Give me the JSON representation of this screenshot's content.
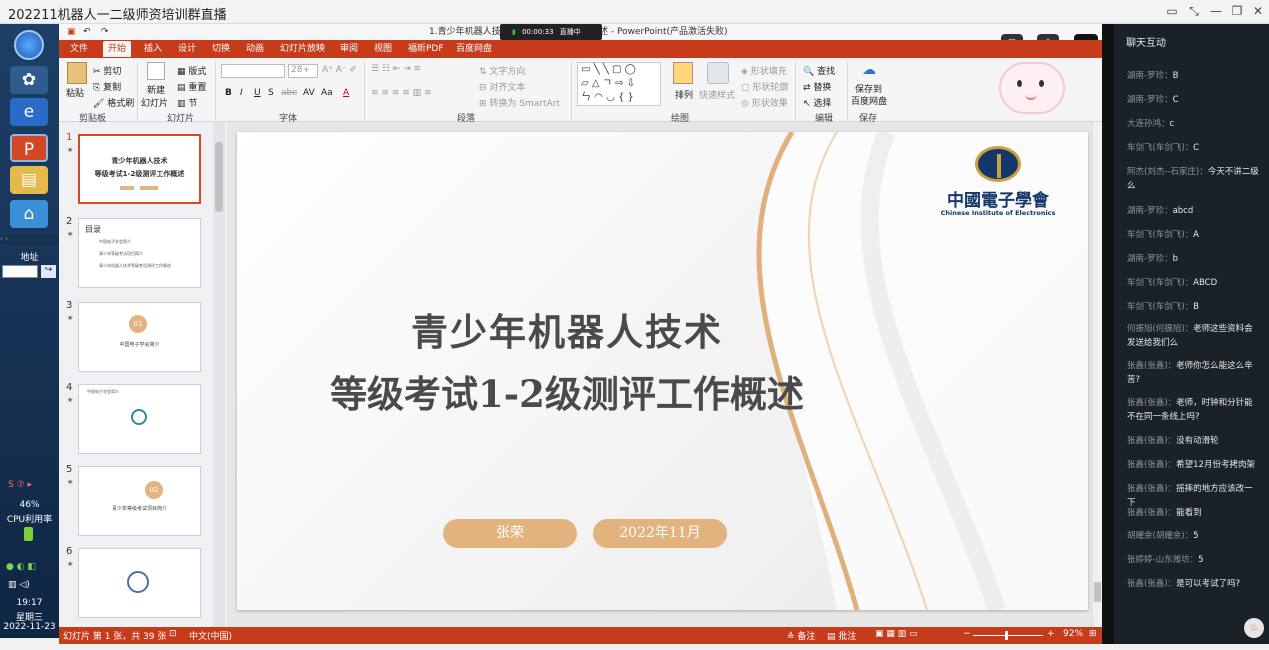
{
  "window": {
    "title": "202211机器人一二级师资培训群直播",
    "controls": [
      "pin-icon",
      "fullscreen-icon",
      "minimize-icon",
      "restore-icon",
      "close-icon"
    ]
  },
  "live": {
    "time": "00:00:33",
    "label": "直播中"
  },
  "ppt": {
    "title_left": "1.青少年机器人技",
    "title_right": "述 - PowerPoint(产品激活失败)",
    "qat": {
      "save": "save-icon",
      "undo": "undo-icon",
      "redo": "redo-icon"
    },
    "tabs": [
      "文件",
      "开始",
      "插入",
      "设计",
      "切换",
      "动画",
      "幻灯片放映",
      "审阅",
      "视图",
      "福昕PDF",
      "百度网盘"
    ],
    "ribbon": {
      "clipboard": {
        "paste": "粘贴",
        "cut": "剪切",
        "copy": "复制",
        "painter": "格式刷",
        "label": "剪贴板"
      },
      "slides": {
        "new": "新建",
        "new2": "幻灯片",
        "layout": "版式",
        "reset": "重置",
        "section": "节",
        "label": "幻灯片"
      },
      "font": {
        "size": "28+",
        "label": "字体",
        "buttons": [
          "B",
          "I",
          "U",
          "S",
          "abc",
          "AV",
          "Aa",
          "A"
        ]
      },
      "paragraph": {
        "direction": "文字方向",
        "align": "对齐文本",
        "smartart": "转换为 SmartArt",
        "label": "段落"
      },
      "drawing": {
        "arrange": "排列",
        "quick": "快速样式",
        "fill": "形状填充",
        "outline": "形状轮廓",
        "effect": "形状效果",
        "label": "绘图"
      },
      "editing": {
        "find": "查找",
        "replace": "替换",
        "select": "选择",
        "label": "编辑"
      },
      "save": {
        "l1": "保存到",
        "l2": "百度网盘",
        "label": "保存"
      }
    },
    "thumbs": [
      {
        "num": "1",
        "t1": "青少年机器人技术",
        "t2": "等级考试1-2级测评工作概述"
      },
      {
        "num": "2",
        "heading": "目录",
        "items": [
          "中国电子学会简介",
          "青少年等级考试项目简介",
          "青少年机器人技术等级考试测评工作概述"
        ]
      },
      {
        "num": "3",
        "big": "01",
        "text": "中国电子学会简介"
      },
      {
        "num": "4",
        "text": "中国电子学会简介"
      },
      {
        "num": "5",
        "big": "02",
        "text": "青少年等级考试项目简介"
      },
      {
        "num": "6"
      }
    ],
    "slide": {
      "title1": "青少年机器人技术",
      "title2": "等级考试1-2级测评工作概述",
      "logo_cn": "中國電子學會",
      "logo_en": "Chinese Institute of Electronics",
      "presenter": "张荣",
      "date": "2022年11月"
    },
    "status": {
      "slide": "幻灯片 第 1 张，共 39 张",
      "lang": "中文(中国)",
      "notes": "备注",
      "comments": "批注",
      "zoom": "92%"
    }
  },
  "taskbar": {
    "addr": "地址",
    "cpu_pct": "46%",
    "cpu_label": "CPU利用率",
    "time": "19:17",
    "weekday": "星期三",
    "date": "2022-11-23"
  },
  "chat": {
    "title": "聊天互动",
    "messages": [
      {
        "user": "湖南-罗珍：",
        "text": "B"
      },
      {
        "user": "湖南-罗珍：",
        "text": "C"
      },
      {
        "user": "大连孙鸿：",
        "text": "c"
      },
      {
        "user": "车剑飞(车剑飞)：",
        "text": "C"
      },
      {
        "user": "阿杰(刘杰--石家庄)：",
        "text": "今天不讲二级么"
      },
      {
        "user": "湖南-罗珍：",
        "text": "abcd"
      },
      {
        "user": "车剑飞(车剑飞)：",
        "text": "A"
      },
      {
        "user": "湖南-罗珍：",
        "text": "b"
      },
      {
        "user": "车剑飞(车剑飞)：",
        "text": "ABCD"
      },
      {
        "user": "车剑飞(车剑飞)：",
        "text": "B"
      },
      {
        "user": "何振旭(何振旭)：",
        "text": "老师这些资料会发送给我们么"
      },
      {
        "user": "张鑫(张鑫)：",
        "text": "老师你怎么能这么辛苦?"
      },
      {
        "user": "张鑫(张鑫)：",
        "text": "老师，时钟和分针能不在同一条线上吗?"
      },
      {
        "user": "张鑫(张鑫)：",
        "text": "没有动滑轮"
      },
      {
        "user": "张鑫(张鑫)：",
        "text": "希望12月份考拷肉架"
      },
      {
        "user": "张鑫(张鑫)：",
        "text": "摇摔的地方应该改一下"
      },
      {
        "user": "张鑫(张鑫)：",
        "text": "能看到"
      },
      {
        "user": "胡耀余(胡耀余)：",
        "text": "5"
      },
      {
        "user": "张婷婷-山东潍坊：",
        "text": "5"
      },
      {
        "user": "张鑫(张鑫)：",
        "text": "是可以考试了吗?"
      }
    ]
  },
  "colors": {
    "accent": "#c63b1a",
    "gold": "#d9a56b",
    "chat_bg": "#1b2129"
  }
}
